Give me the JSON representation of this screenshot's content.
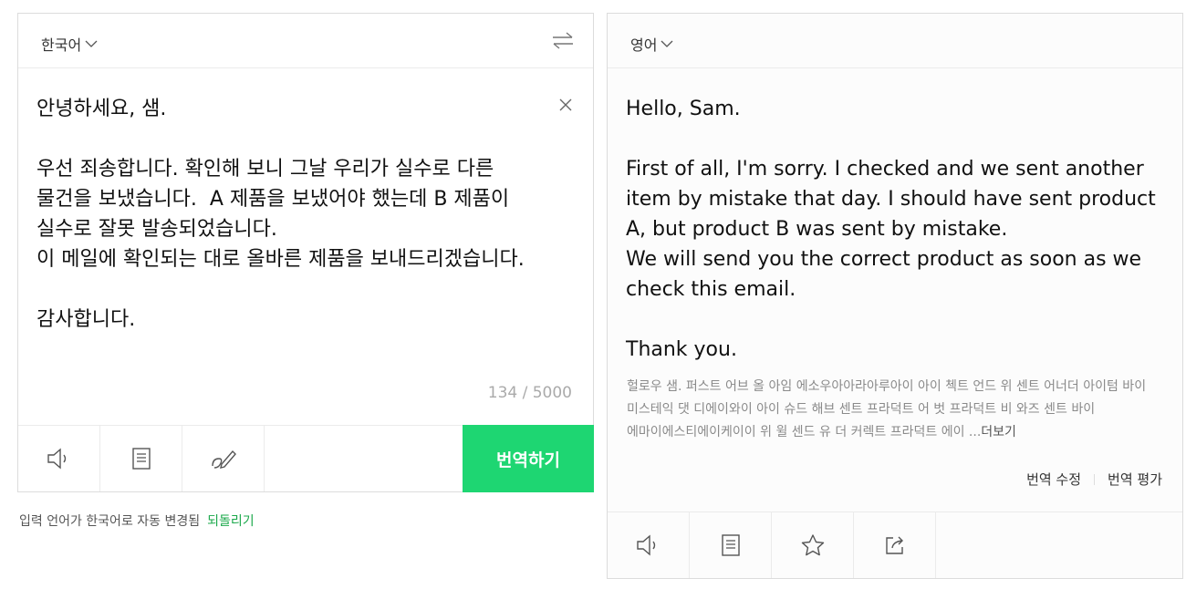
{
  "source": {
    "language": "한국어",
    "text": "안녕하세요, 샘.\n\n우선 죄송합니다. 확인해 보니 그날 우리가 실수로 다른 물건을 보냈습니다.  A 제품을 보냈어야 했는데 B 제품이 실수로 잘못 발송되었습니다.\n이 메일에 확인되는 대로 올바른 제품을 보내드리겠습니다.\n\n감사합니다.",
    "char_count": "134 / 5000",
    "translate_label": "번역하기",
    "icons": [
      "speaker-icon",
      "copy-icon",
      "handwriting-icon",
      "swap-icon",
      "close-icon"
    ]
  },
  "target": {
    "language": "영어",
    "text": "Hello, Sam.\n\nFirst of all, I'm sorry. I checked and we sent another item by mistake that day. I should have sent product A, but product B was sent by mistake.\nWe will send you the correct product as soon as we check this email.\n\nThank you.",
    "pronunciation": "헐로우 샘. 퍼스트 어브 올 아임 에소우아아라아루아이 아이 첵트 언드 위 센트 어너더 아이텀 바이 미스테익 댓 디에이와이 아이 슈드 해브 센트 프라덕트 어 벗 프라덕트 비 와즈 센트 바이 에마이에스티에이케이이 위 윌 센드 유 더 커렉트 프라덕트 에이 ...",
    "more_label": "더보기",
    "edit_label": "번역 수정",
    "rate_label": "번역 평가",
    "icons": [
      "speaker-icon",
      "copy-icon",
      "star-icon",
      "share-icon"
    ]
  },
  "notice": {
    "text": "입력 언어가 한국어로 자동 변경됨",
    "revert_label": "되돌리기"
  },
  "colors": {
    "accent": "#1ed672",
    "link": "#1aa84a"
  }
}
